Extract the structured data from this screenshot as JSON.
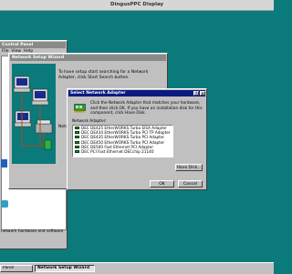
{
  "display_title": "DingusPPC Display",
  "control_panel": {
    "title": "Control Panel",
    "menu": [
      "File",
      "View",
      "Help"
    ],
    "status": "network hardware and software"
  },
  "wizard": {
    "title": "Network Setup Wizard",
    "intro": "To have setup start searching for a Network Adapter, click Start Search button.",
    "network_label": "Netw"
  },
  "dialog": {
    "title": "Select Network Adapter",
    "instructions": "Click the Network Adapter that matches your hardware, and then click OK. If you have an installation disk for this component, click Have Disk.",
    "list_label": "Network Adapter:",
    "adapters": [
      "DEC DE425 EtherWORKS Turbo EISA Adapter",
      "DEC DE434 EtherWORKS Turbo PCI TP Adapter",
      "DEC DE435 EtherWORKS Turbo PCI Adapter",
      "DEC DE450 EtherWORKS Turbo PCI Adapter",
      "DEC DE500 Fast Ethernet PCI Adapter",
      "DEC PCI Fast Ethernet DECchip 21140"
    ],
    "have_disk": "Have Disk...",
    "ok": "OK",
    "cancel": "Cancel"
  },
  "taskbar": {
    "items": [
      "Panel",
      "Network Setup Wizard"
    ]
  }
}
